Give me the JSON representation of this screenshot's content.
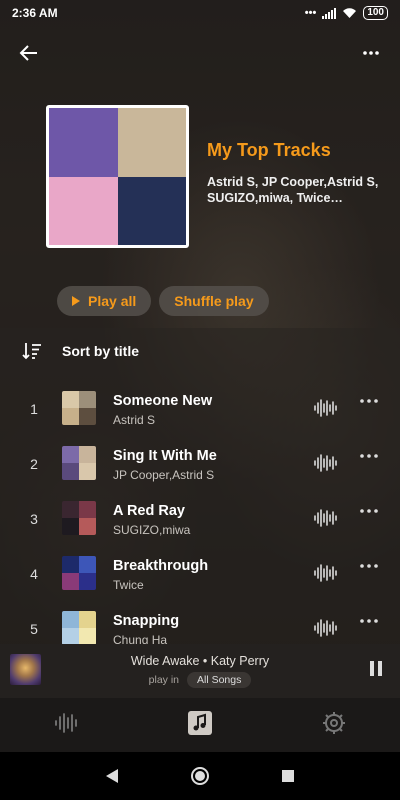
{
  "status_bar": {
    "time": "2:36 AM",
    "dots": "•••",
    "battery": "100"
  },
  "topbar": {
    "back_icon": "arrow-left-icon",
    "more_icon": "more-horizontal-icon"
  },
  "playlist": {
    "title": "My Top Tracks",
    "artists": "Astrid S, JP Cooper,Astrid S, SUGIZO,miwa, Twice…",
    "cover_colors": [
      "#6e57a8",
      "#c9b79a",
      "#e9a7c8",
      "#243056"
    ]
  },
  "actions": {
    "play_all": "Play all",
    "shuffle_play": "Shuffle play"
  },
  "sort": {
    "label": "Sort by title",
    "icon": "sort-icon"
  },
  "tracks": [
    {
      "num": "1",
      "title": "Someone New",
      "artist": "Astrid S",
      "colors": [
        "#d9c8a8",
        "#9c8f7a",
        "#c7b08a",
        "#5d4e3f"
      ]
    },
    {
      "num": "2",
      "title": "Sing It With Me",
      "artist": "JP Cooper,Astrid S",
      "colors": [
        "#7c6aa8",
        "#c8b49b",
        "#5a4a7c",
        "#d9c7ab"
      ]
    },
    {
      "num": "3",
      "title": "A Red Ray",
      "artist": "SUGIZO,miwa",
      "colors": [
        "#3a2630",
        "#7a3848",
        "#1e1a20",
        "#b55a5a"
      ]
    },
    {
      "num": "4",
      "title": "Breakthrough",
      "artist": "Twice",
      "colors": [
        "#1d2a6a",
        "#3d56b8",
        "#8a3a78",
        "#2b2f8a"
      ]
    },
    {
      "num": "5",
      "title": "Snapping",
      "artist": "Chung Ha",
      "colors": [
        "#8fb6d8",
        "#e4d38e",
        "#b4d0e6",
        "#f2e8b0"
      ]
    }
  ],
  "mini_player": {
    "title": "Wide Awake • Katy Perry",
    "play_in": "play in",
    "source": "All Songs"
  },
  "bottom_nav": {
    "items": [
      "waveform-icon",
      "music-note-icon",
      "settings-icon"
    ]
  },
  "system_nav": {
    "items": [
      "back-triangle-icon",
      "home-circle-icon",
      "recents-square-icon"
    ]
  },
  "colors": {
    "accent": "#f59a1b",
    "background": "#1b1917"
  }
}
